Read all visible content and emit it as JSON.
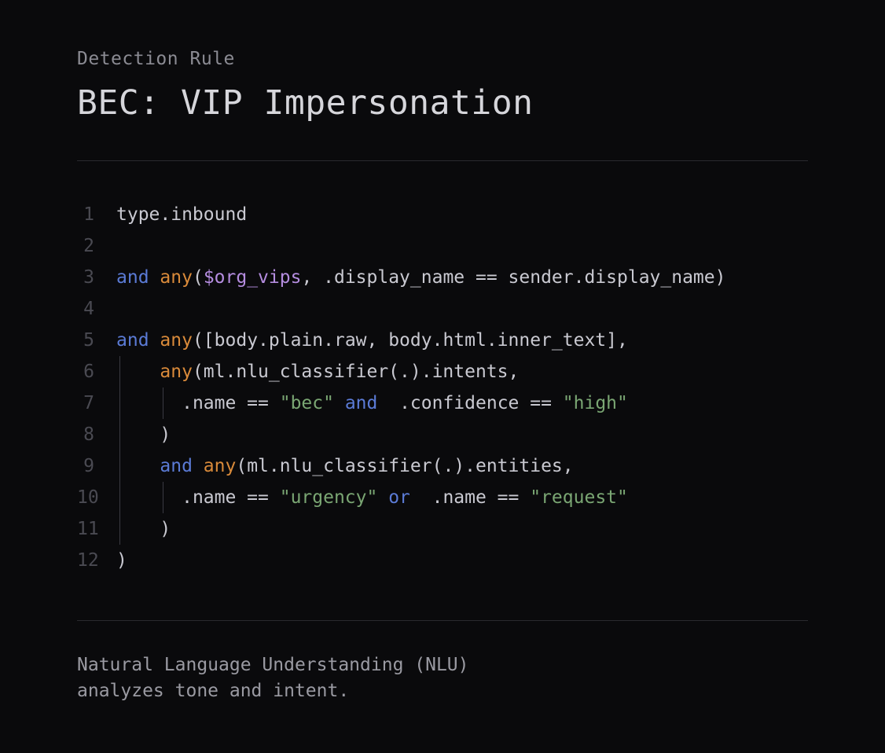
{
  "eyebrow": "Detection Rule",
  "title": "BEC: VIP Impersonation",
  "footer_line1": "Natural Language Understanding (NLU)",
  "footer_line2": "analyzes tone and intent.",
  "code": {
    "line_numbers": [
      "1",
      "2",
      "3",
      "4",
      "5",
      "6",
      "7",
      "8",
      "9",
      "10",
      "11",
      "12"
    ],
    "lines": [
      {
        "indent": 0,
        "tokens": [
          {
            "t": "type.inbound",
            "c": "plain"
          }
        ]
      },
      {
        "indent": 0,
        "tokens": []
      },
      {
        "indent": 0,
        "tokens": [
          {
            "t": "and",
            "c": "kw-and"
          },
          {
            "t": " ",
            "c": "plain"
          },
          {
            "t": "any",
            "c": "kw-any"
          },
          {
            "t": "(",
            "c": "plain"
          },
          {
            "t": "$org_vips",
            "c": "kw-var"
          },
          {
            "t": ", .display_name == sender.display_name)",
            "c": "plain"
          }
        ]
      },
      {
        "indent": 0,
        "tokens": []
      },
      {
        "indent": 0,
        "guides": [],
        "tokens": [
          {
            "t": "and",
            "c": "kw-and"
          },
          {
            "t": " ",
            "c": "plain"
          },
          {
            "t": "any",
            "c": "kw-any"
          },
          {
            "t": "([body.plain.raw, body.html.inner_text],",
            "c": "plain"
          }
        ]
      },
      {
        "indent": 4,
        "guides": [
          0
        ],
        "tokens": [
          {
            "t": "any",
            "c": "kw-any"
          },
          {
            "t": "(ml.nlu_classifier(.).intents,",
            "c": "plain"
          }
        ]
      },
      {
        "indent": 6,
        "guides": [
          0,
          4
        ],
        "tokens": [
          {
            "t": ".name == ",
            "c": "plain"
          },
          {
            "t": "\"bec\"",
            "c": "kw-str"
          },
          {
            "t": " ",
            "c": "plain"
          },
          {
            "t": "and",
            "c": "kw-and"
          },
          {
            "t": "  .confidence == ",
            "c": "plain"
          },
          {
            "t": "\"high\"",
            "c": "kw-str"
          }
        ]
      },
      {
        "indent": 4,
        "guides": [
          0
        ],
        "tokens": [
          {
            "t": ")",
            "c": "plain"
          }
        ]
      },
      {
        "indent": 4,
        "guides": [
          0
        ],
        "tokens": [
          {
            "t": "and",
            "c": "kw-and"
          },
          {
            "t": " ",
            "c": "plain"
          },
          {
            "t": "any",
            "c": "kw-any"
          },
          {
            "t": "(ml.nlu_classifier(.).entities,",
            "c": "plain"
          }
        ]
      },
      {
        "indent": 6,
        "guides": [
          0,
          4
        ],
        "tokens": [
          {
            "t": ".name == ",
            "c": "plain"
          },
          {
            "t": "\"urgency\"",
            "c": "kw-str"
          },
          {
            "t": " ",
            "c": "plain"
          },
          {
            "t": "or",
            "c": "kw-and"
          },
          {
            "t": "  .name == ",
            "c": "plain"
          },
          {
            "t": "\"request\"",
            "c": "kw-str"
          }
        ]
      },
      {
        "indent": 4,
        "guides": [
          0
        ],
        "tokens": [
          {
            "t": ")",
            "c": "plain"
          }
        ]
      },
      {
        "indent": 0,
        "tokens": [
          {
            "t": ")",
            "c": "plain"
          }
        ]
      }
    ]
  }
}
